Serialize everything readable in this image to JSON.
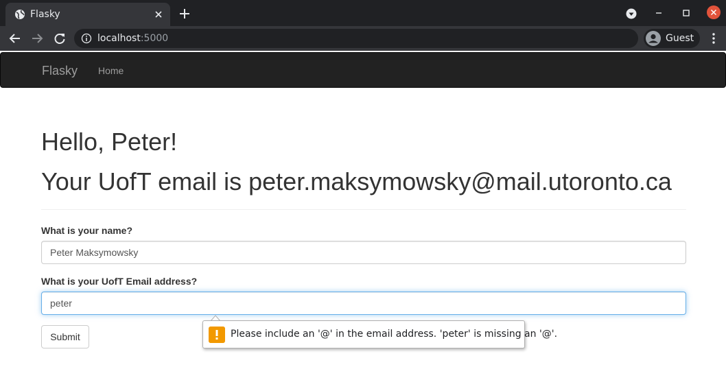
{
  "browser": {
    "tab_title": "Flasky",
    "url_host": "localhost",
    "url_port": ":5000",
    "profile_label": "Guest",
    "colors": {
      "frame": "#202124",
      "toolbar": "#35363a",
      "close_button": "#e2533b"
    }
  },
  "navbar": {
    "brand": "Flasky",
    "links": [
      {
        "label": "Home"
      }
    ]
  },
  "page": {
    "greeting": "Hello, Peter!",
    "email_line": "Your UofT email is peter.maksymowsky@mail.utoronto.ca"
  },
  "form": {
    "name_label": "What is your name?",
    "name_value": "Peter Maksymowsky",
    "email_label": "What is your UofT Email address?",
    "email_value": "peter",
    "submit_label": "Submit"
  },
  "validation": {
    "message": "Please include an '@' in the email address. 'peter' is missing an '@'.",
    "icon": "warning-icon",
    "icon_color": "#f29900"
  }
}
